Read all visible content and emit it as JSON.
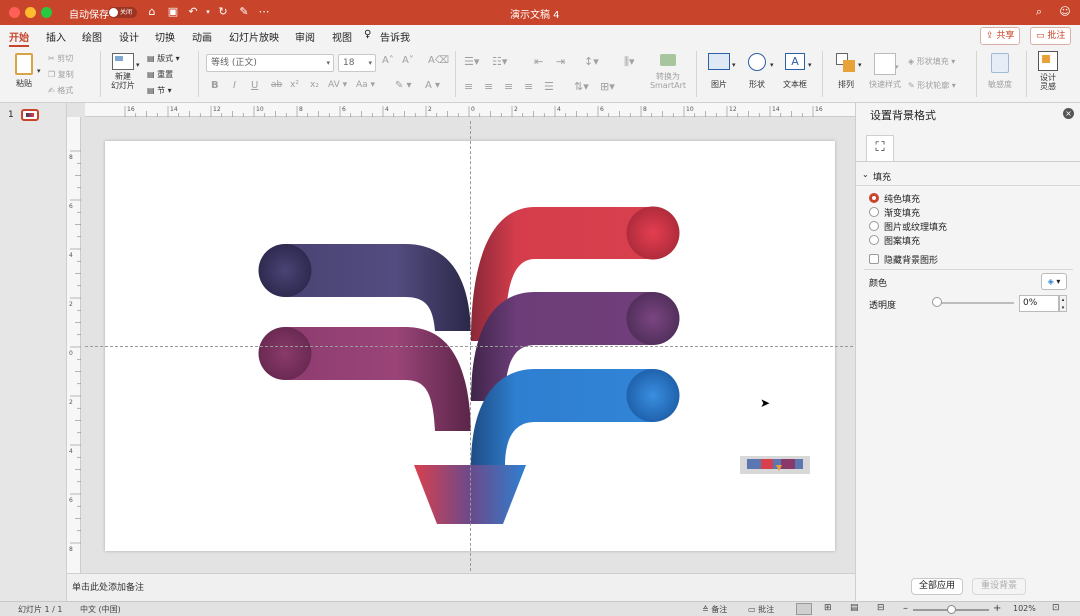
{
  "titlebar": {
    "autosave_label": "自动保存",
    "autosave_state": "关闭",
    "doc_title": "演示文稿 4"
  },
  "tabs": [
    {
      "label": "开始"
    },
    {
      "label": "插入"
    },
    {
      "label": "绘图"
    },
    {
      "label": "设计"
    },
    {
      "label": "切换"
    },
    {
      "label": "动画"
    },
    {
      "label": "幻灯片放映"
    },
    {
      "label": "审阅"
    },
    {
      "label": "视图"
    },
    {
      "label": "告诉我"
    }
  ],
  "actions": {
    "share": "共享",
    "comment": "批注"
  },
  "ribbon": {
    "paste": "粘贴",
    "cut": "剪切",
    "copy": "复制",
    "format": "格式",
    "new_slide": "新建\n幻灯片",
    "layout": "版式",
    "reset": "重置",
    "section": "节",
    "font_name": "等线 (正文)",
    "font_size": "18",
    "smartart": "转换为\nSmartArt",
    "picture": "图片",
    "shape": "形状",
    "textbox": "文本框",
    "arrange": "排列",
    "quick_styles": "快速样式",
    "shape_fill": "形状填充",
    "shape_outline": "形状轮廓",
    "sensitivity": "敏感度",
    "designer": "设计\n灵感"
  },
  "thumb": {
    "number": "1"
  },
  "notes_placeholder": "单击此处添加备注",
  "pane": {
    "title": "设置背景格式",
    "section": "填充",
    "fill_options": [
      {
        "label": "纯色填充",
        "checked": true
      },
      {
        "label": "渐变填充",
        "checked": false
      },
      {
        "label": "图片或纹理填充",
        "checked": false
      },
      {
        "label": "图案填充",
        "checked": false
      }
    ],
    "hide_bg": "隐藏背景图形",
    "color_label": "颜色",
    "transparency_label": "透明度",
    "transparency_value": "0%",
    "apply_all": "全部应用",
    "reset_bg": "重设背景"
  },
  "status": {
    "slide_info": "幻灯片 1 / 1",
    "language": "中文 (中国)",
    "notes": "备注",
    "comments": "批注",
    "zoom": "102%"
  },
  "ruler_h": [
    "16",
    "14",
    "12",
    "10",
    "8",
    "6",
    "4",
    "2",
    "0",
    "2",
    "4",
    "6",
    "8",
    "10",
    "12",
    "14",
    "16"
  ],
  "ruler_v": [
    "8",
    "6",
    "4",
    "2",
    "0",
    "2",
    "4",
    "6",
    "8"
  ],
  "colors": {
    "accent": "#c8452b",
    "navy": "#3e3a66",
    "magenta": "#8a3a6a",
    "red": "#d9404e",
    "purple": "#6c3d78",
    "blue": "#2f7fd1"
  }
}
